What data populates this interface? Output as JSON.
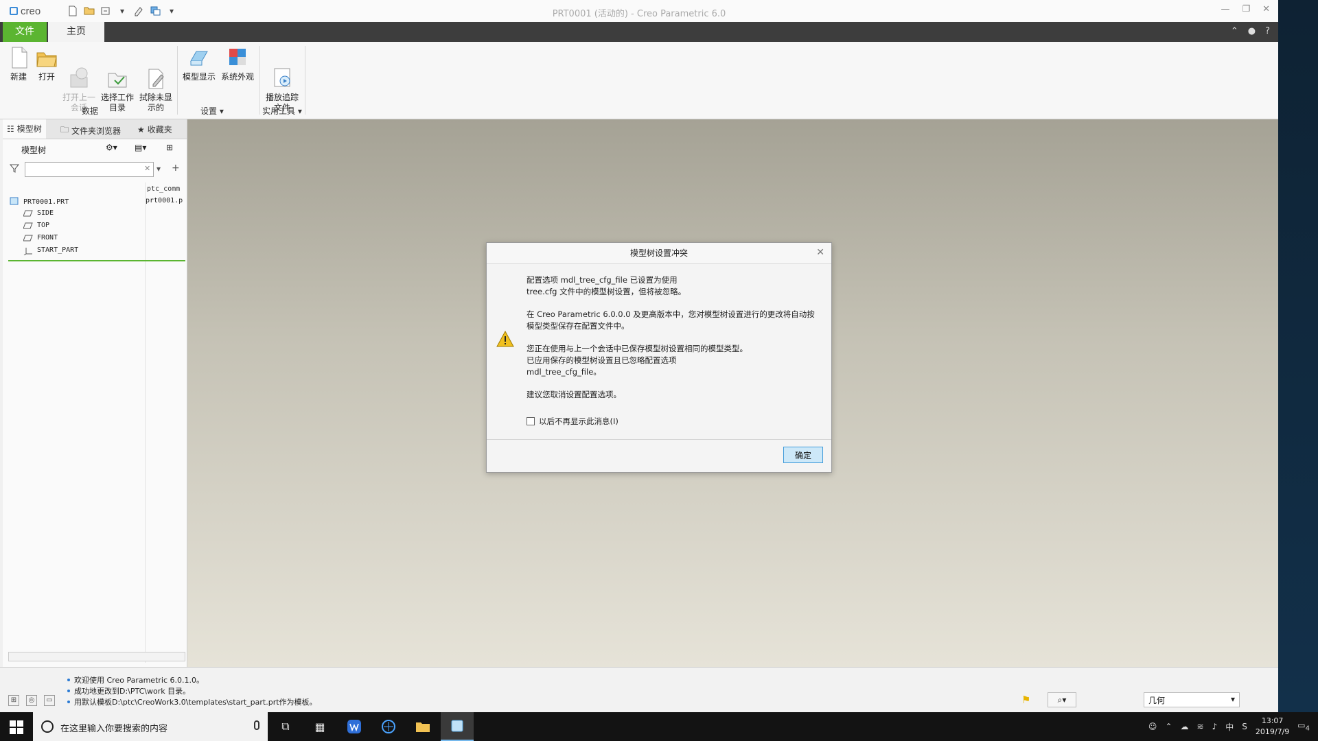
{
  "window": {
    "title": "PRT0001 (活动的) - Creo Parametric 6.0",
    "logo": "creo"
  },
  "menu": {
    "file": "文件",
    "home": "主页"
  },
  "ribbon": {
    "data_group": "数据",
    "settings_group": "设置",
    "utilities_group": "实用工具",
    "buttons": {
      "new": "新建",
      "open": "打开",
      "open_last": "打开上一\n会话",
      "select_dir": "选择工作\n目录",
      "erase": "拭除未显\n示的",
      "model_display": "模型显示",
      "system_appearance": "系统外观",
      "play_trail": "播放追踪\n文件"
    }
  },
  "panel": {
    "tabs": {
      "model_tree": "模型树",
      "folder_browser": "文件夹浏览器",
      "favorites": "收藏夹"
    },
    "title": "模型树",
    "column_header": "ptc_comm",
    "root": "PRT0001.PRT",
    "root_value": "prt0001.p",
    "items": [
      "SIDE",
      "TOP",
      "FRONT",
      "START_PART"
    ]
  },
  "dialog": {
    "title": "模型树设置冲突",
    "paragraphs": [
      "配置选项 mdl_tree_cfg_file 已设置为使用\ntree.cfg 文件中的模型树设置，但将被忽略。",
      "在 Creo Parametric 6.0.0.0 及更高版本中，您对模型树设置进行的更改将自动按\n模型类型保存在配置文件中。",
      "您正在使用与上一个会话中已保存模型树设置相同的模型类型。\n已应用保存的模型树设置且已忽略配置选项\nmdl_tree_cfg_file。",
      "建议您取消设置配置选项。"
    ],
    "checkbox": "以后不再显示此消息(I)",
    "ok": "确定"
  },
  "status": {
    "messages": [
      "欢迎使用 Creo Parametric 6.0.1.0。",
      "成功地更改到D:\\PTC\\work 目录。",
      "用默认模板D:\\ptc\\CreoWork3.0\\templates\\start_part.prt作为模板。"
    ],
    "filter": "几何"
  },
  "taskbar": {
    "search_placeholder": "在这里输入你要搜索的内容",
    "time": "13:07",
    "date": "2019/7/9",
    "ime": "中",
    "notifications": "4"
  },
  "colors": {
    "accent_green": "#5bb531",
    "ok_border": "#3f9ad9",
    "warning": "#e8b400"
  }
}
